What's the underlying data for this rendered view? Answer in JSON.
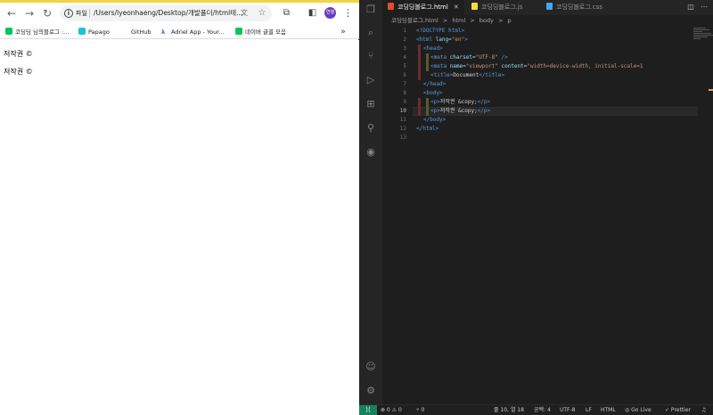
{
  "browser": {
    "omnibox": {
      "file_label": "파일",
      "url": "/Users/lyeonhaeng/Desktop/개발폴더/html테..."
    },
    "profile_initials": "연행",
    "bookmarks": [
      {
        "label": "코딩딩 님의블로그 :...",
        "color": "#03c75a"
      },
      {
        "label": "Papago",
        "color": "#19c2d5"
      },
      {
        "label": "GitHub",
        "color": "#ffffff"
      },
      {
        "label": "Adriel App - Your...",
        "color": "#3b5bdb"
      },
      {
        "label": "네이버 글꼴 모음",
        "color": "#03c75a"
      }
    ],
    "content": {
      "paragraphs": [
        "저작권 ©",
        "저작권 ©"
      ]
    }
  },
  "vscode": {
    "tabs": [
      {
        "label": "코딩딩블로그.html",
        "active": true,
        "icon_color": "#e44d26"
      },
      {
        "label": "코딩딩블로그.js",
        "active": false,
        "icon_color": "#f1dd3f"
      },
      {
        "label": "코딩딩블로그.css",
        "active": false,
        "icon_color": "#42a5f5"
      }
    ],
    "breadcrumb": [
      "코딩딩블로그.html",
      ">",
      "html",
      ">",
      "body",
      ">",
      "p"
    ],
    "line_numbers": [
      "1",
      "2",
      "3",
      "4",
      "5",
      "6",
      "7",
      "8",
      "9",
      "10",
      "11",
      "12",
      "13"
    ],
    "current_line": "10",
    "code": {
      "l1": "<!DOCTYPE html>",
      "l2a": "<html",
      "l2b": " lang=",
      "l2c": "\"en\"",
      "l2d": ">",
      "l3": "<head>",
      "l4a": "<meta",
      "l4b": " charset=",
      "l4c": "\"UTF-8\"",
      "l4d": " />",
      "l5a": "<meta",
      "l5b": " name=",
      "l5c": "\"viewport\"",
      "l5d": " content=",
      "l5e": "\"width=device-width, initial-scale=1",
      "l6a": "<title>",
      "l6b": "Document",
      "l6c": "</title>",
      "l7": "</head>",
      "l8": "<body>",
      "l9a": "<p>",
      "l9b": "저작권 &copy;",
      "l9c": "</p>",
      "l10a": "<p>",
      "l10b": "저작권 &copy;",
      "l10c": "</p>",
      "l11": "</body>",
      "l12": "</html>"
    },
    "status": {
      "errors": "⊗ 0 ⚠ 0",
      "ports": "⑂ 0",
      "position": "줄 10, 열 18",
      "spaces": "공백: 4",
      "encoding": "UTF-8",
      "eol": "LF",
      "language": "HTML",
      "golive": "Go Live",
      "prettier": "✓ Prettier"
    }
  }
}
